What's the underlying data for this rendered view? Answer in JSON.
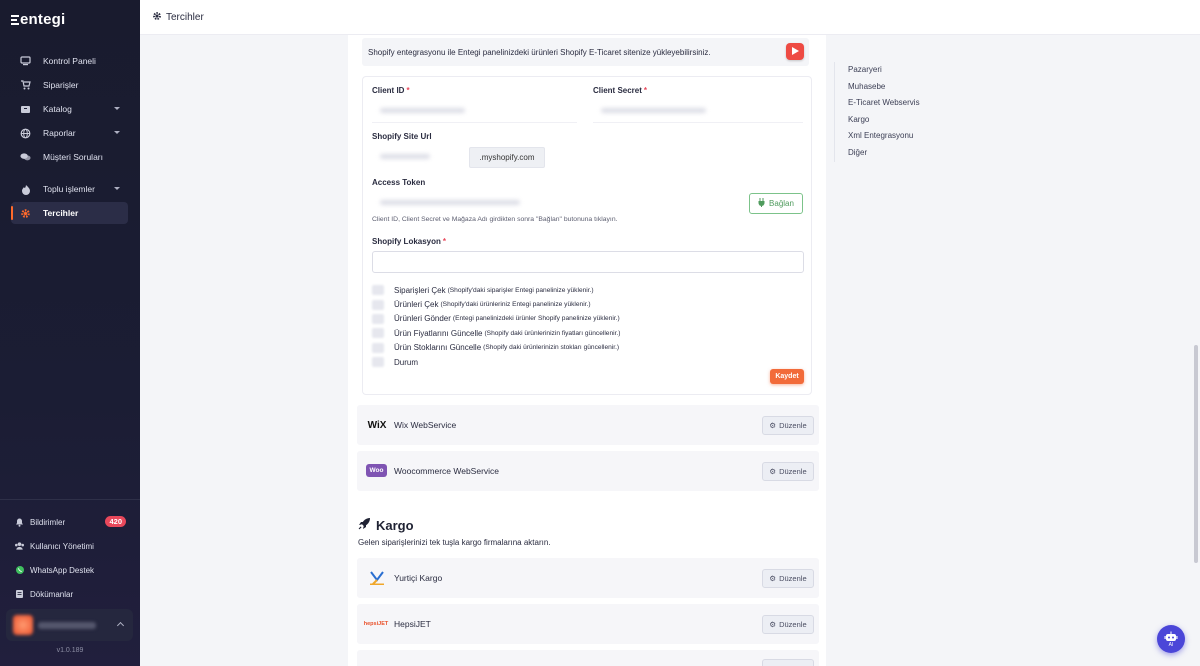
{
  "brand": "entegi",
  "sidebar": {
    "items": [
      {
        "label": "Kontrol Paneli",
        "icon": "monitor-icon"
      },
      {
        "label": "Siparişler",
        "icon": "cart-icon"
      },
      {
        "label": "Katalog",
        "icon": "box-icon"
      },
      {
        "label": "Raporlar",
        "icon": "globe-icon"
      },
      {
        "label": "Müşteri Soruları",
        "icon": "chat-icon"
      },
      {
        "label": "Toplu işlemler",
        "icon": "fire-icon"
      },
      {
        "label": "Tercihler",
        "icon": "gear-icon"
      }
    ],
    "bottom": [
      {
        "label": "Bildirimler",
        "icon": "bell-icon",
        "badge": "420"
      },
      {
        "label": "Kullanıcı Yönetimi",
        "icon": "users-icon"
      },
      {
        "label": "WhatsApp Destek",
        "icon": "whatsapp-icon"
      },
      {
        "label": "Dökümanlar",
        "icon": "document-icon"
      }
    ],
    "version": "v1.0.189"
  },
  "header": {
    "title": "Tercihler"
  },
  "shopify": {
    "info": "Shopify entegrasyonu ile Entegi panelinizdeki ürünleri Shopify E-Ticaret sitenize yükleyebilirsiniz.",
    "client_id_label": "Client ID",
    "client_secret_label": "Client Secret",
    "site_url_label": "Shopify Site Url",
    "site_url_suffix": ".myshopify.com",
    "access_token_label": "Access Token",
    "connect_label": "Bağlan",
    "hint": "Client ID, Client Secret ve Mağaza Adı girdikten sonra \"Bağlan\" butonuna tıklayın.",
    "location_label": "Shopify Lokasyon",
    "required_mark": "*",
    "options": [
      {
        "label": "Siparişleri Çek",
        "note": "(Shopify'daki siparişler Entegi panelinize yüklenir.)"
      },
      {
        "label": "Ürünleri Çek",
        "note": "(Shopify'daki ürünleriniz Entegi panelinize yüklenir.)"
      },
      {
        "label": "Ürünleri Gönder",
        "note": "(Entegi panelinizdeki ürünler Shopify panelinize yüklenir.)"
      },
      {
        "label": "Ürün Fiyatlarını Güncelle",
        "note": "(Shopify daki ürünlerinizin fiyatları güncellenir.)"
      },
      {
        "label": "Ürün Stoklarını Güncelle",
        "note": "(Shopify daki ürünlerinizin stokları güncellenir.)"
      },
      {
        "label": "Durum",
        "note": ""
      }
    ],
    "save_label": "Kaydet"
  },
  "integrations": [
    {
      "name": "Wix WebService",
      "logo": "WiX",
      "edit": "Düzenle"
    },
    {
      "name": "Woocommerce WebService",
      "logo": "Woo",
      "edit": "Düzenle"
    }
  ],
  "kargo": {
    "title": "Kargo",
    "subtitle": "Gelen siparişlerinizi tek tuşla kargo firmalarına aktarın.",
    "items": [
      {
        "name": "Yurtiçi Kargo",
        "edit": "Düzenle"
      },
      {
        "name": "HepsiJET",
        "logo": "hepsiJET",
        "edit": "Düzenle"
      }
    ]
  },
  "right_nav": [
    "Pazaryeri",
    "Muhasebe",
    "E-Ticaret Webservis",
    "Kargo",
    "Xml Entegrasyonu",
    "Diğer"
  ],
  "ai_label": "AI",
  "colors": {
    "accent": "#f26b3a",
    "sidebar": "#1b1d34",
    "connect": "#4f9b5d",
    "badge": "#e9485b"
  }
}
